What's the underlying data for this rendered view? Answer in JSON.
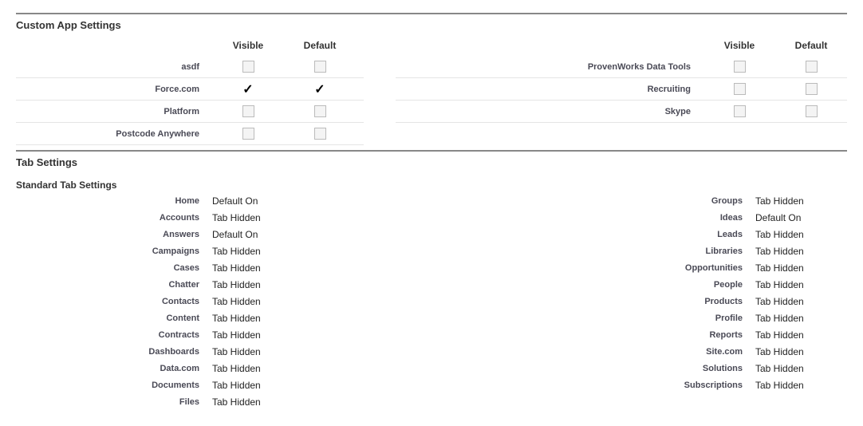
{
  "customAppSettings": {
    "title": "Custom App Settings",
    "headers": {
      "visible": "Visible",
      "default": "Default"
    },
    "left": [
      {
        "label": "asdf",
        "visible": "unchecked",
        "default": "unchecked"
      },
      {
        "label": "Force.com",
        "visible": "checked",
        "default": "checked"
      },
      {
        "label": "Platform",
        "visible": "unchecked",
        "default": "unchecked"
      },
      {
        "label": "Postcode Anywhere",
        "visible": "unchecked",
        "default": "unchecked"
      }
    ],
    "right": [
      {
        "label": "ProvenWorks Data Tools",
        "visible": "unchecked",
        "default": "unchecked"
      },
      {
        "label": "Recruiting",
        "visible": "unchecked",
        "default": "unchecked"
      },
      {
        "label": "Skype",
        "visible": "unchecked",
        "default": "unchecked"
      }
    ]
  },
  "tabSettings": {
    "title": "Tab Settings",
    "standardTitle": "Standard Tab Settings",
    "left": [
      {
        "label": "Home",
        "value": "Default On"
      },
      {
        "label": "Accounts",
        "value": "Tab Hidden"
      },
      {
        "label": "Answers",
        "value": "Default On"
      },
      {
        "label": "Campaigns",
        "value": "Tab Hidden"
      },
      {
        "label": "Cases",
        "value": "Tab Hidden"
      },
      {
        "label": "Chatter",
        "value": "Tab Hidden"
      },
      {
        "label": "Contacts",
        "value": "Tab Hidden"
      },
      {
        "label": "Content",
        "value": "Tab Hidden"
      },
      {
        "label": "Contracts",
        "value": "Tab Hidden"
      },
      {
        "label": "Dashboards",
        "value": "Tab Hidden"
      },
      {
        "label": "Data.com",
        "value": "Tab Hidden"
      },
      {
        "label": "Documents",
        "value": "Tab Hidden"
      },
      {
        "label": "Files",
        "value": "Tab Hidden"
      }
    ],
    "right": [
      {
        "label": "Groups",
        "value": "Tab Hidden"
      },
      {
        "label": "Ideas",
        "value": "Default On"
      },
      {
        "label": "Leads",
        "value": "Tab Hidden"
      },
      {
        "label": "Libraries",
        "value": "Tab Hidden"
      },
      {
        "label": "Opportunities",
        "value": "Tab Hidden"
      },
      {
        "label": "People",
        "value": "Tab Hidden"
      },
      {
        "label": "Products",
        "value": "Tab Hidden"
      },
      {
        "label": "Profile",
        "value": "Tab Hidden"
      },
      {
        "label": "Reports",
        "value": "Tab Hidden"
      },
      {
        "label": "Site.com",
        "value": "Tab Hidden"
      },
      {
        "label": "Solutions",
        "value": "Tab Hidden"
      },
      {
        "label": "Subscriptions",
        "value": "Tab Hidden"
      }
    ]
  }
}
